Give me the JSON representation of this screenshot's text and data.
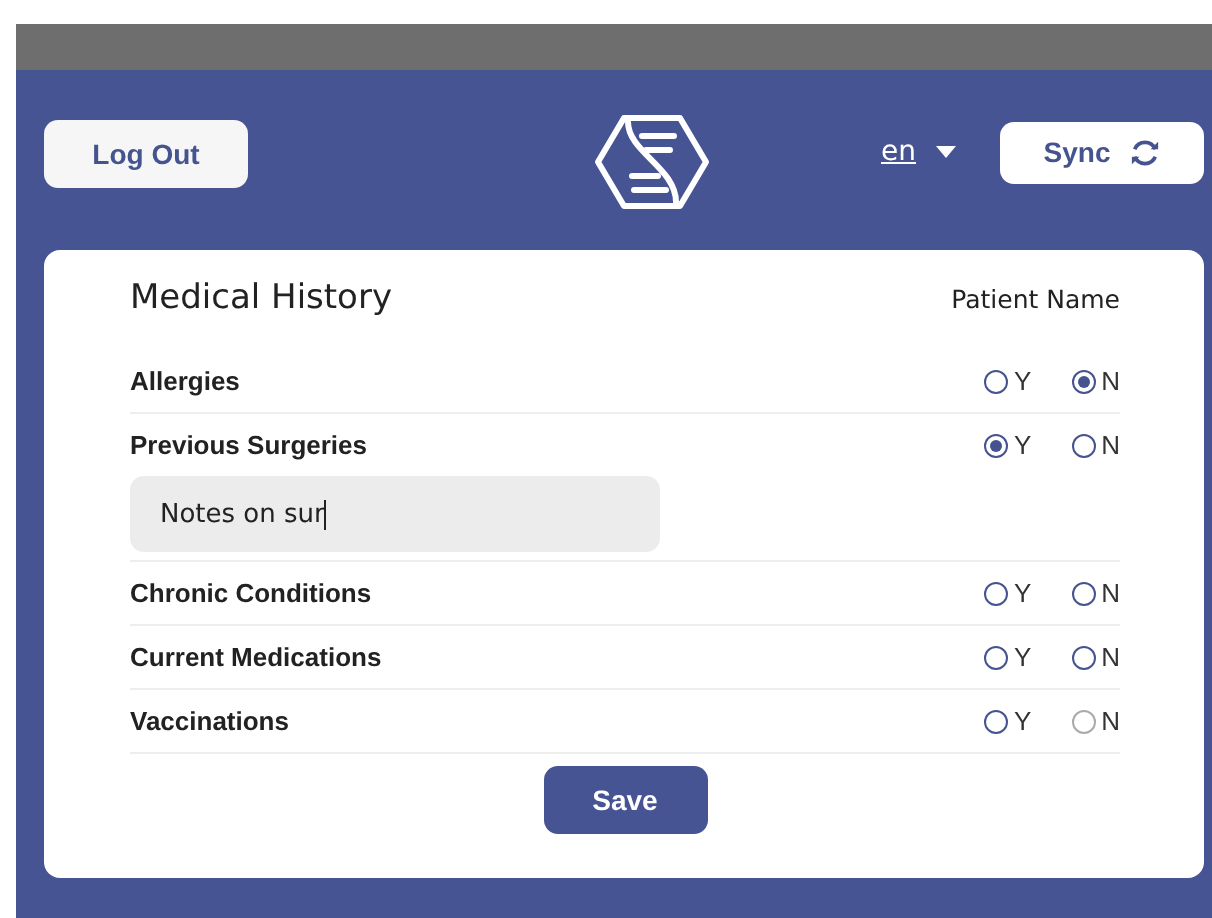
{
  "header": {
    "logout_button": "Log Out",
    "language": "en",
    "sync_button": "Sync"
  },
  "form": {
    "title": "Medical History",
    "patient_name": "Patient Name",
    "questions": [
      {
        "label": "Allergies",
        "options": [
          {
            "label": "Y",
            "selected": false,
            "disabled": false
          },
          {
            "label": "N",
            "selected": true,
            "disabled": false
          }
        ]
      },
      {
        "label": "Previous Surgeries",
        "options": [
          {
            "label": "Y",
            "selected": true,
            "disabled": false
          },
          {
            "label": "N",
            "selected": false,
            "disabled": false
          }
        ],
        "notes": {
          "value": "Notes on sur"
        }
      },
      {
        "label": "Chronic Conditions",
        "options": [
          {
            "label": "Y",
            "selected": false,
            "disabled": false
          },
          {
            "label": "N",
            "selected": false,
            "disabled": false
          }
        ]
      },
      {
        "label": "Current Medications",
        "options": [
          {
            "label": "Y",
            "selected": false,
            "disabled": false
          },
          {
            "label": "N",
            "selected": false,
            "disabled": false
          }
        ]
      },
      {
        "label": "Vaccinations",
        "options": [
          {
            "label": "Y",
            "selected": false,
            "disabled": false
          },
          {
            "label": "N",
            "selected": false,
            "disabled": true
          }
        ]
      }
    ],
    "save_button": "Save"
  }
}
